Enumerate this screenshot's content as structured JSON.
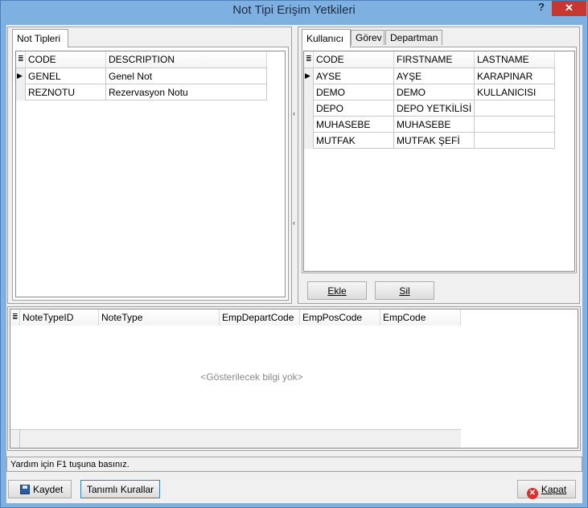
{
  "window": {
    "title": "Not Tipi Erişim Yetkileri",
    "help_label": "?",
    "close_label": "✕"
  },
  "left_tabs": [
    {
      "label": "Not Tipleri"
    }
  ],
  "note_types_grid": {
    "indicator_icon": "≣",
    "columns": [
      "CODE",
      "DESCRIPTION"
    ],
    "rows": [
      {
        "code": "GENEL",
        "description": "Genel Not",
        "current": true
      },
      {
        "code": "REZNOTU",
        "description": "Rezervasyon Notu",
        "current": false
      }
    ]
  },
  "right_tabs": [
    {
      "label": "Kullanıcı",
      "active": true
    },
    {
      "label": "Görev",
      "active": false
    },
    {
      "label": "Departman",
      "active": false
    }
  ],
  "users_grid": {
    "indicator_icon": "≣",
    "columns": [
      "CODE",
      "FIRSTNAME",
      "LASTNAME"
    ],
    "rows": [
      {
        "code": "AYSE",
        "firstname": "AYŞE",
        "lastname": "KARAPINAR",
        "current": true
      },
      {
        "code": "DEMO",
        "firstname": "DEMO",
        "lastname": "KULLANICISI",
        "current": false
      },
      {
        "code": "DEPO",
        "firstname": "DEPO YETKİLİSİ",
        "lastname": "",
        "current": false
      },
      {
        "code": "MUHASEBE",
        "firstname": "MUHASEBE",
        "lastname": "",
        "current": false
      },
      {
        "code": "MUTFAK",
        "firstname": "MUTFAK ŞEFİ",
        "lastname": "",
        "current": false
      }
    ]
  },
  "buttons": {
    "add_label": "Ekle",
    "delete_label": "Sil",
    "save_label": "Kaydet",
    "rules_label": "Tanımlı Kurallar",
    "close_label": "Kapat"
  },
  "access_grid": {
    "indicator_icon": "≣",
    "columns": [
      "NoteTypeID",
      "NoteType",
      "EmpDepartCode",
      "EmpPosCode",
      "EmpCode"
    ],
    "empty_message": "<Gösterilecek bilgi yok>"
  },
  "status": {
    "text": "Yardım için F1 tuşuna basınız."
  },
  "icons": {
    "row_pointer": "triangle-right-icon",
    "splitter_left": "chevron-left-icon",
    "save": "floppy-disk-icon",
    "close": "red-x-icon"
  },
  "colors": {
    "titlebar": "#7eb0e2",
    "close_button": "#c7372f",
    "empty_text": "#8a8a8a"
  }
}
